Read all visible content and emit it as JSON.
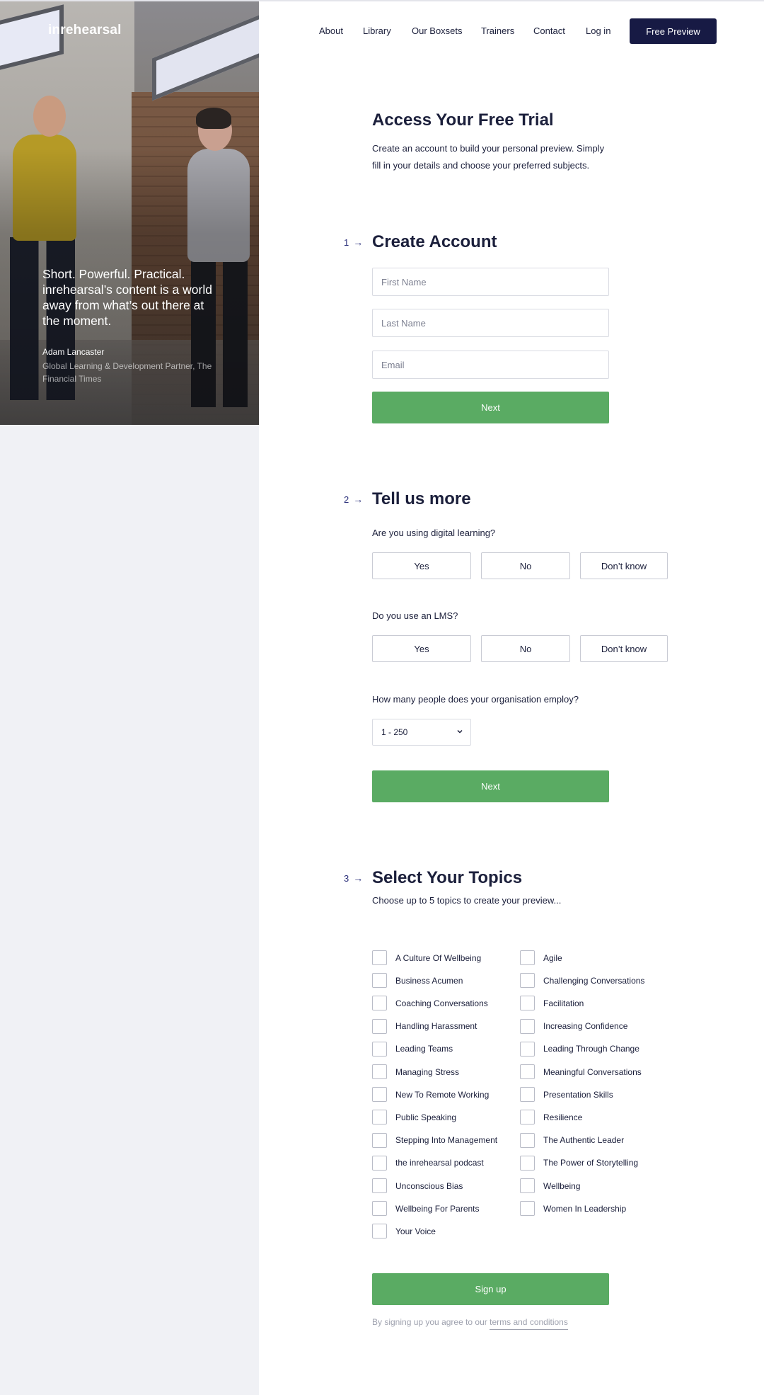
{
  "brand": {
    "logo": "inrehearsal"
  },
  "nav": {
    "links": [
      "About",
      "Library",
      "Our Boxsets",
      "Trainers",
      "Contact",
      "Log in"
    ],
    "cta": "Free Preview"
  },
  "testimonial": {
    "quote": "Short. Powerful. Practical. inrehearsal’s content is a world away from what’s out there at the moment.",
    "author": "Adam Lancaster",
    "role": "Global Learning & Development Partner, The Financial Times"
  },
  "intro": {
    "title": "Access Your Free Trial",
    "text": "Create an account to build your personal preview. Simply fill in your details and choose your preferred subjects."
  },
  "step1": {
    "number": "1",
    "title": "Create Account",
    "fields": [
      {
        "placeholder": "First Name"
      },
      {
        "placeholder": "Last Name"
      },
      {
        "placeholder": "Email"
      }
    ],
    "next": "Next"
  },
  "step2": {
    "number": "2",
    "title": "Tell us more",
    "q1": {
      "label": "Are you using digital learning?",
      "options": [
        "Yes",
        "No",
        "Don’t know"
      ]
    },
    "q2": {
      "label": "Do you use an LMS?",
      "options": [
        "Yes",
        "No",
        "Don’t know"
      ]
    },
    "q3": {
      "label": "How many people does your organisation employ?",
      "value": "1 - 250"
    },
    "next": "Next"
  },
  "step3": {
    "number": "3",
    "title": "Select Your Topics",
    "subtitle": "Choose up to 5 topics to create your preview...",
    "topics_left": [
      "A Culture Of Wellbeing",
      "Business Acumen",
      "Coaching Conversations",
      "Handling Harassment",
      "Leading Teams",
      "Managing Stress",
      "New To Remote Working",
      "Public Speaking",
      "Stepping Into Management",
      "the inrehearsal podcast",
      "Unconscious Bias",
      "Wellbeing For Parents",
      "Your Voice"
    ],
    "topics_right": [
      "Agile",
      "Challenging Conversations",
      "Facilitation",
      "Increasing Confidence",
      "Leading Through Change",
      "Meaningful Conversations",
      "Presentation Skills",
      "Resilience",
      "The Authentic Leader",
      "The Power of Storytelling",
      "Wellbeing",
      "Women In Leadership"
    ],
    "submit": "Sign up",
    "terms_prefix": "By signing up you agree to our",
    "terms_link": "terms and conditions"
  },
  "colors": {
    "accent_green": "#5aab63",
    "navy": "#171a44",
    "step_blue": "#2a2f7a"
  }
}
